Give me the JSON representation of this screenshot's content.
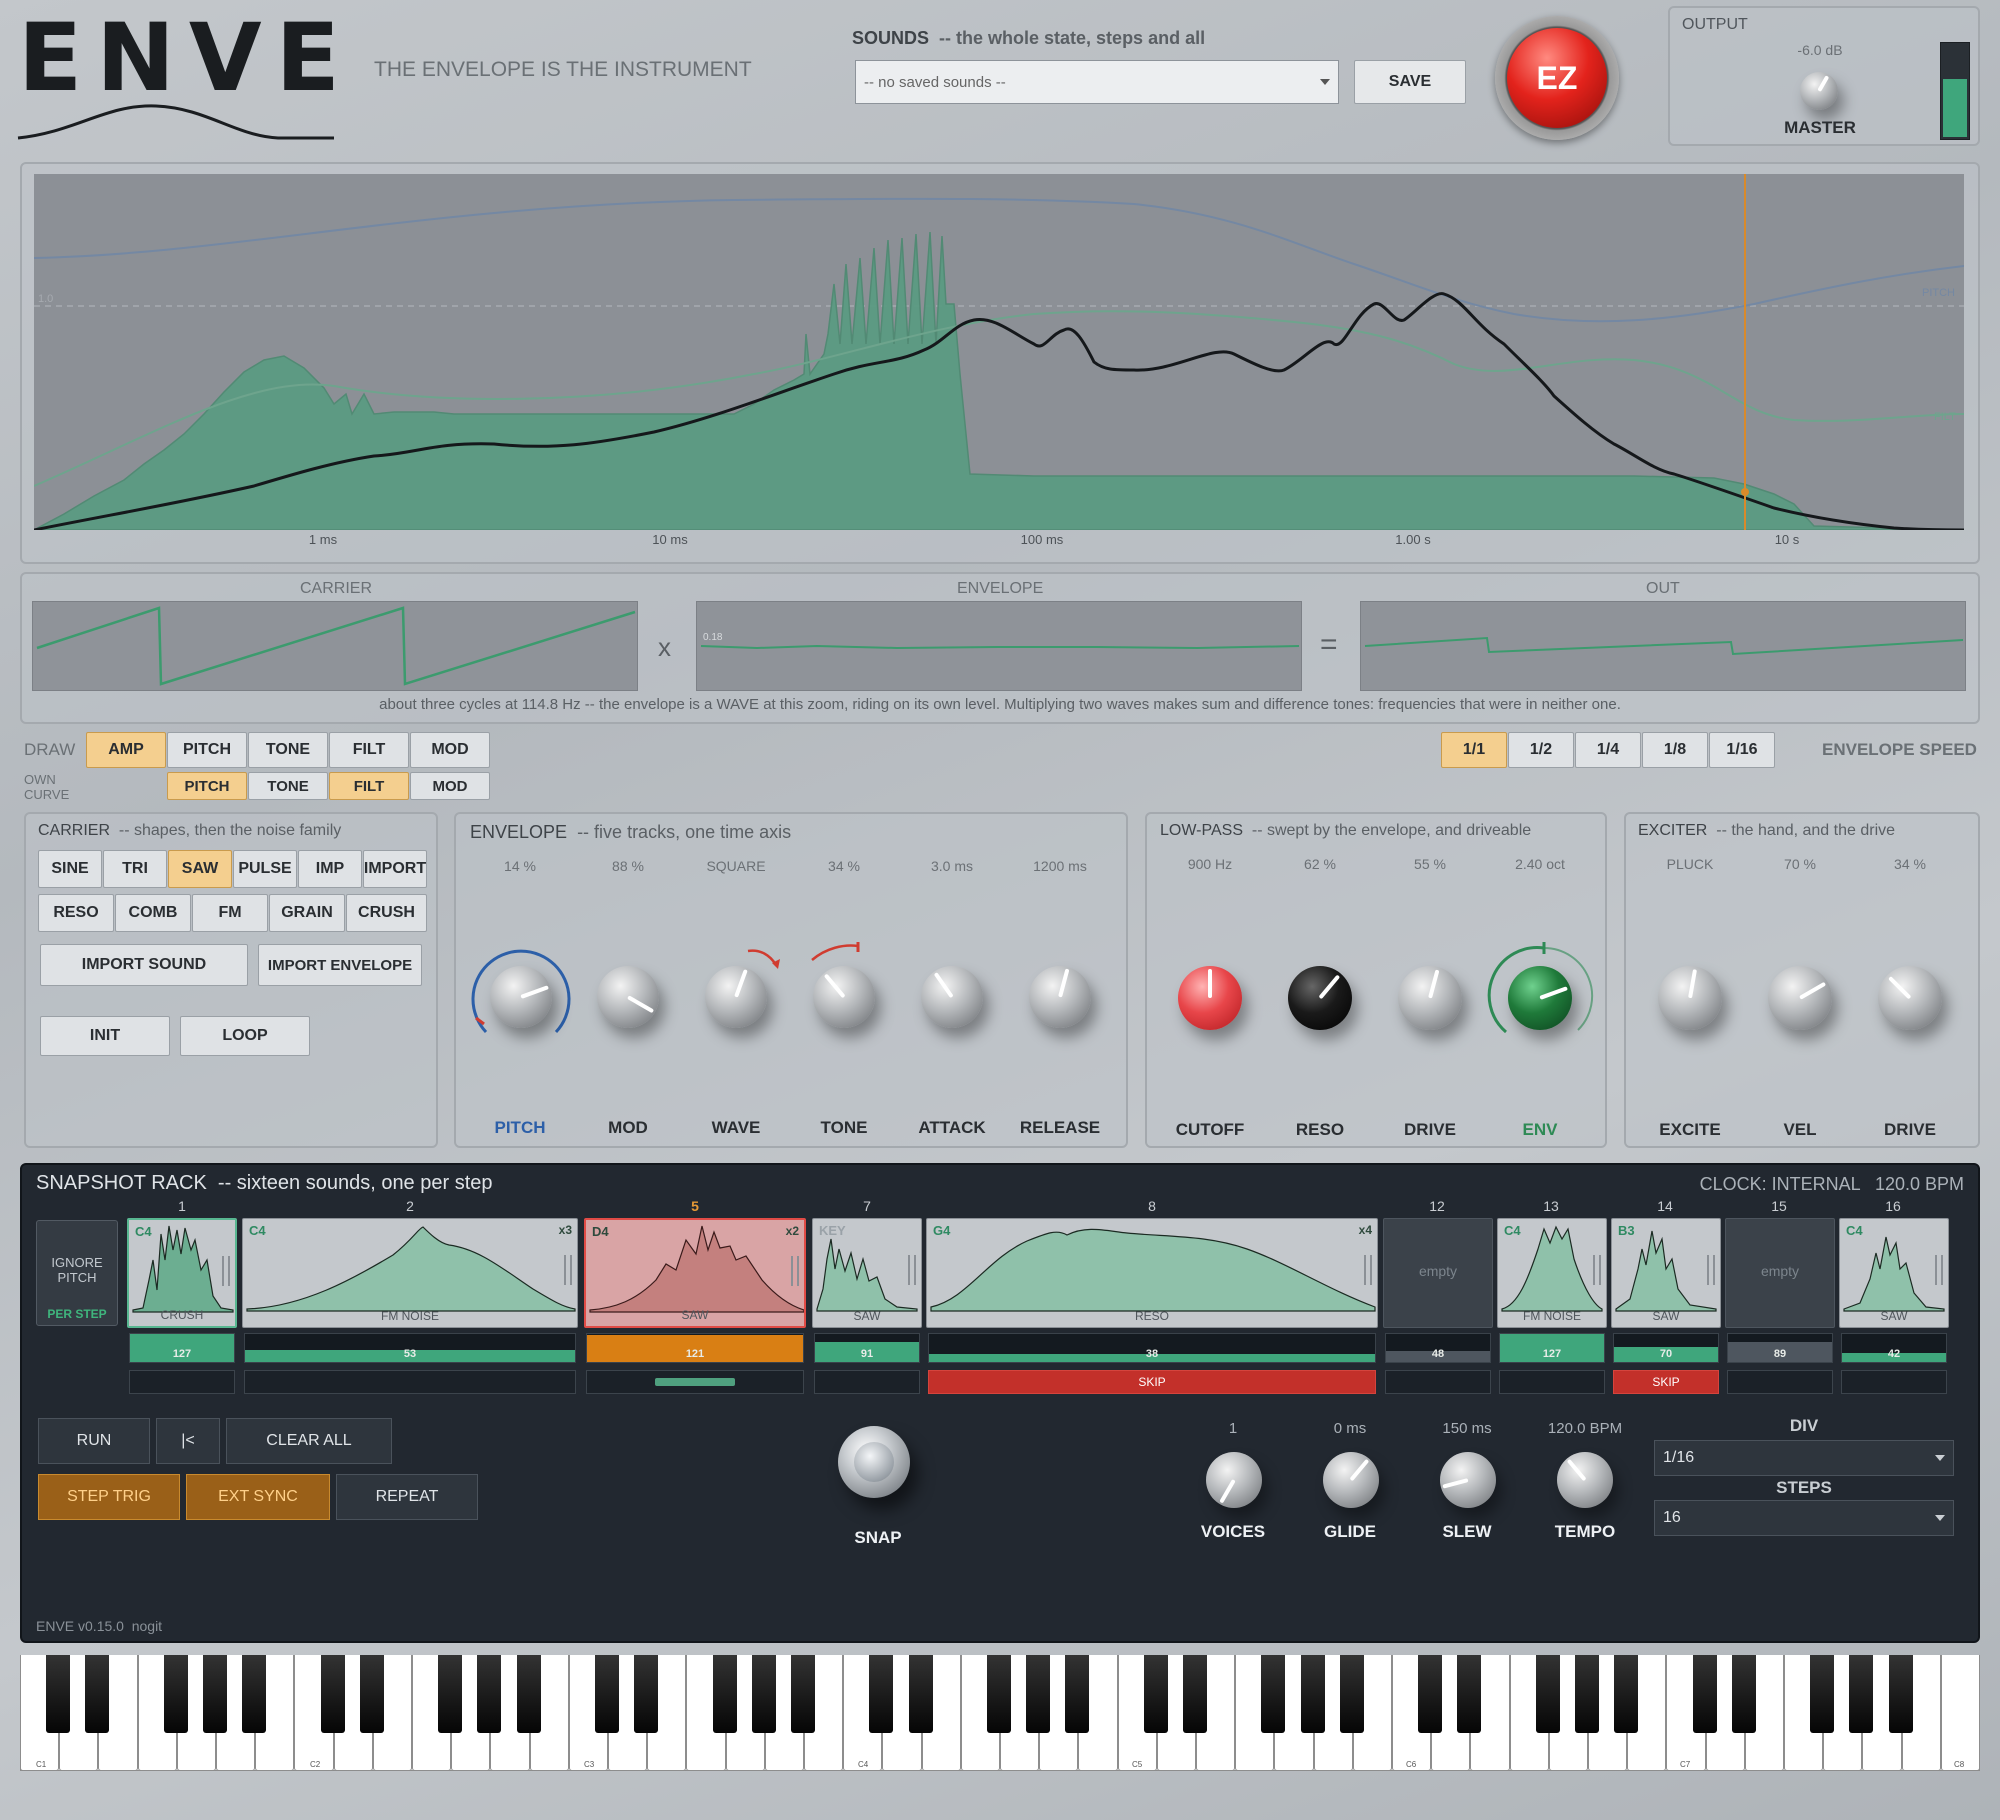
{
  "app": {
    "logo": "ENVE",
    "tagline": "THE ENVELOPE IS THE INSTRUMENT",
    "version": "ENVE v0.15.0  nogit"
  },
  "sounds": {
    "label": "SOUNDS",
    "subtitle": "--  the whole state, steps and all",
    "selected": "-- no saved sounds --",
    "save": "SAVE"
  },
  "ez": "EZ",
  "output": {
    "title": "OUTPUT",
    "level": "-6.0 dB",
    "knob": "MASTER",
    "meter": 0.62
  },
  "main_plot": {
    "ticks": [
      "1 ms",
      "10 ms",
      "100 ms",
      "1.00 s",
      "10 s"
    ],
    "ref": "1.0",
    "pitch": "PITCH",
    "filt": "FILT"
  },
  "scopes": {
    "carrier": "CARRIER",
    "envelope": "ENVELOPE",
    "out": "OUT",
    "times": "x",
    "equals": "=",
    "env_value": "0.18",
    "caption": "about three cycles at 114.8 Hz  --  the envelope is a WAVE at this zoom, riding on its own level.  Multiplying two waves makes sum and difference tones: frequencies that were in neither one."
  },
  "draw": {
    "label": "DRAW",
    "own": "OWN",
    "curve": "CURVE",
    "tracks": [
      "AMP",
      "PITCH",
      "TONE",
      "FILT",
      "MOD"
    ],
    "own_tracks": [
      "PITCH",
      "TONE",
      "FILT",
      "MOD"
    ],
    "speed_label": "ENVELOPE SPEED",
    "speeds": [
      "1/1",
      "1/2",
      "1/4",
      "1/8",
      "1/16"
    ]
  },
  "carrier": {
    "title": "CARRIER",
    "subtitle": "--  shapes, then the noise family",
    "row1": [
      "SINE",
      "TRI",
      "SAW",
      "PULSE",
      "IMP",
      "IMPORT"
    ],
    "row2": [
      "RESO",
      "COMB",
      "FM",
      "GRAIN",
      "CRUSH"
    ],
    "import_sound": "IMPORT SOUND",
    "import_envelope": "IMPORT ENVELOPE",
    "init": "INIT",
    "loop": "LOOP"
  },
  "envelope": {
    "title": "ENVELOPE",
    "subtitle": "--  five tracks, one time axis",
    "knobs": [
      {
        "label": "PITCH",
        "value": "14 %"
      },
      {
        "label": "MOD",
        "value": "88 %"
      },
      {
        "label": "WAVE",
        "value": "SQUARE"
      },
      {
        "label": "TONE",
        "value": "34 %"
      },
      {
        "label": "ATTACK",
        "value": "3.0 ms"
      },
      {
        "label": "RELEASE",
        "value": "1200 ms"
      }
    ]
  },
  "lowpass": {
    "title": "LOW-PASS",
    "subtitle": "--  swept by the envelope, and driveable",
    "knobs": [
      {
        "label": "CUTOFF",
        "value": "900 Hz"
      },
      {
        "label": "RESO",
        "value": "62 %"
      },
      {
        "label": "DRIVE",
        "value": "55 %"
      },
      {
        "label": "ENV",
        "value": "2.40 oct"
      }
    ]
  },
  "exciter": {
    "title": "EXCITER",
    "subtitle": "--  the hand, and the drive",
    "knobs": [
      {
        "label": "EXCITE",
        "value": "PLUCK"
      },
      {
        "label": "VEL",
        "value": "70 %"
      },
      {
        "label": "DRIVE",
        "value": "34 %"
      }
    ]
  },
  "rack": {
    "title": "SNAPSHOT RACK",
    "subtitle": "--  sixteen sounds, one per step",
    "clock": "CLOCK: INTERNAL   120.0 BPM",
    "ignore": "IGNORE PITCH",
    "per_step": "PER STEP",
    "steps": [
      {
        "num": "1",
        "note": "C4",
        "name": "CRUSH",
        "mult": "",
        "vel": "127"
      },
      {
        "num": "2",
        "note": "C4",
        "name": "FM NOISE",
        "mult": "x3",
        "vel": "53"
      },
      {
        "num": "5",
        "note": "D4",
        "name": "SAW",
        "mult": "x2",
        "vel": "121"
      },
      {
        "num": "7",
        "note": "KEY",
        "name": "SAW",
        "mult": "",
        "vel": "91"
      },
      {
        "num": "8",
        "note": "G4",
        "name": "RESO",
        "mult": "x4",
        "vel": "38",
        "action": "SKIP"
      },
      {
        "num": "12",
        "note": "",
        "name": "",
        "empty": "empty",
        "vel": "48"
      },
      {
        "num": "13",
        "note": "C4",
        "name": "FM NOISE",
        "mult": "",
        "vel": "127"
      },
      {
        "num": "14",
        "note": "B3",
        "name": "SAW",
        "mult": "",
        "vel": "70",
        "action": "SKIP"
      },
      {
        "num": "15",
        "note": "",
        "name": "",
        "empty": "empty",
        "vel": "89"
      },
      {
        "num": "16",
        "note": "C4",
        "name": "SAW",
        "mult": "",
        "vel": "42"
      }
    ],
    "run": "RUN",
    "rewind": "|<",
    "clear": "CLEAR ALL",
    "step_trig": "STEP TRIG",
    "ext_sync": "EXT SYNC",
    "repeat": "REPEAT",
    "snap": "SNAP",
    "knobs": [
      {
        "label": "VOICES",
        "value": "1"
      },
      {
        "label": "GLIDE",
        "value": "0 ms"
      },
      {
        "label": "SLEW",
        "value": "150 ms"
      },
      {
        "label": "TEMPO",
        "value": "120.0 BPM"
      }
    ],
    "div_label": "DIV",
    "div": "1/16",
    "steps_label": "STEPS",
    "steps_value": "16"
  },
  "keyboard": {
    "octaves": [
      "C1",
      "C2",
      "C3",
      "C4",
      "C5",
      "C6",
      "C7",
      "C8"
    ]
  },
  "colors": {
    "accent": "#f4cf8f",
    "green": "#4fa07f",
    "red": "#c3302a",
    "orange": "#d97f14",
    "panel_dark": "#222830"
  }
}
